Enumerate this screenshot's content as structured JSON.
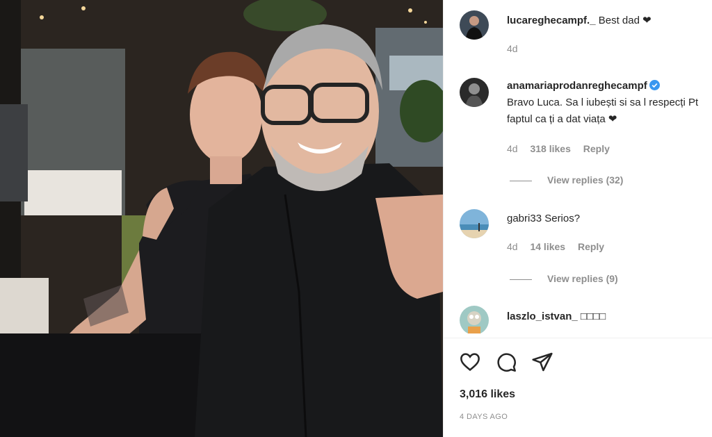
{
  "photo": {
    "alt_icon": "photo-father-son"
  },
  "comments": [
    {
      "username": "lucareghecampf._",
      "text": "Best dad ❤",
      "time": "4d",
      "avatar": "avatar-luca"
    },
    {
      "username": "anamariaprodanreghecampf",
      "verified": true,
      "text": "Bravo Luca. Sa l iubești si sa l respecți Pt faptul ca ți a dat viața ❤",
      "time": "4d",
      "likes": "318 likes",
      "reply": "Reply",
      "view_replies": "View replies (32)",
      "avatar": "avatar-anamaria"
    },
    {
      "username": "gabri33",
      "text": "Serios?",
      "time": "4d",
      "likes": "14 likes",
      "reply": "Reply",
      "view_replies": "View replies (9)",
      "avatar": "avatar-gabri"
    },
    {
      "username": "laszlo_istvan_",
      "text": "□□□□",
      "avatar": "avatar-laszlo"
    }
  ],
  "actions": {
    "like_icon": "heart-icon",
    "comment_icon": "comment-icon",
    "share_icon": "share-icon"
  },
  "post": {
    "likes": "3,016 likes",
    "date": "4 DAYS AGO"
  },
  "colors": {
    "verified": "#3897f0",
    "text": "#262626",
    "muted": "#8e8e8e"
  }
}
